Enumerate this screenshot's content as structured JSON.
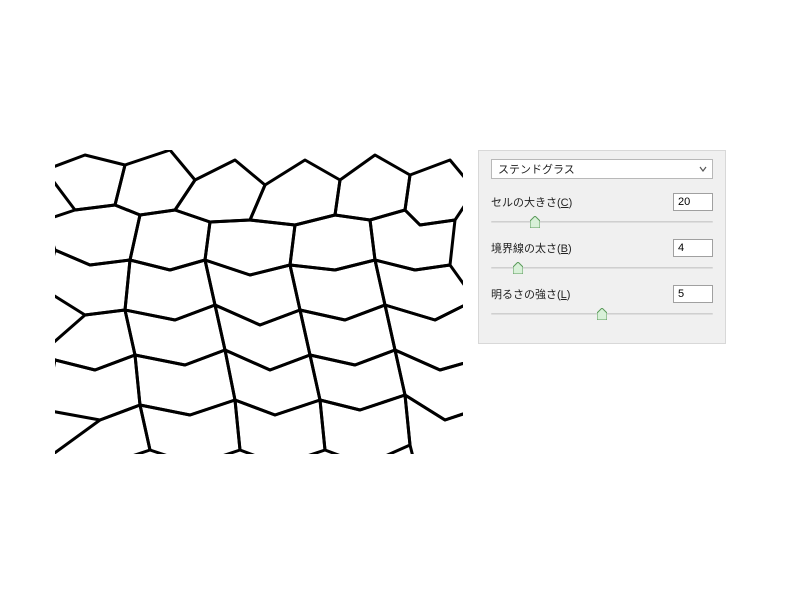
{
  "filter": {
    "dropdown_label": "ステンドグラス",
    "params": [
      {
        "label_pre": "セルの大きさ(",
        "key": "C",
        "label_post": ")",
        "value": "20",
        "thumb_pct": 20
      },
      {
        "label_pre": "境界線の太さ(",
        "key": "B",
        "label_post": ")",
        "value": "4",
        "thumb_pct": 12
      },
      {
        "label_pre": "明るさの強さ(",
        "key": "L",
        "label_post": ")",
        "value": "5",
        "thumb_pct": 50
      }
    ]
  }
}
